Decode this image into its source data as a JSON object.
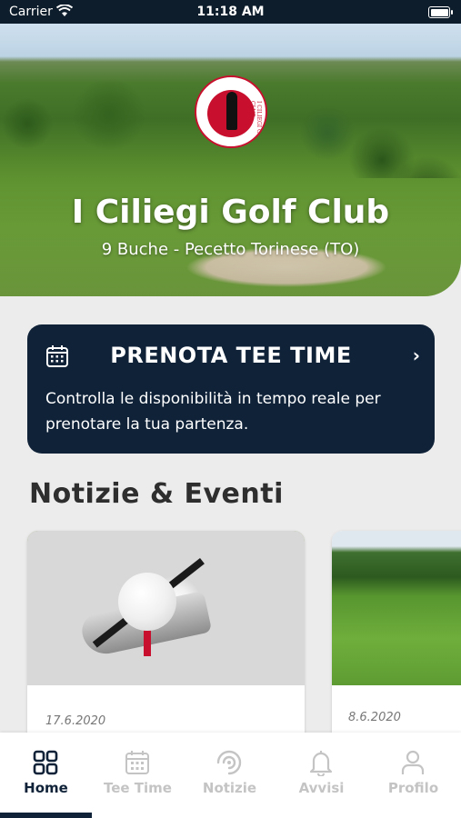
{
  "status_bar": {
    "carrier": "Carrier",
    "time": "11:18 AM"
  },
  "hero": {
    "club_name": "I Ciliegi Golf Club",
    "subtitle": "9 Buche - Pecetto Torinese (TO)",
    "logo_text": "I CILIEGI GOLF CLUB"
  },
  "tee_time_card": {
    "title": "PRENOTA TEE TIME",
    "description": "Controlla le disponibilità in tempo reale per prenotare la tua partenza.",
    "icon": "calendar-icon",
    "chevron_icon": "chevron-right-icon"
  },
  "news": {
    "section_title": "Notizie & Eventi",
    "items": [
      {
        "date": "17.6.2020"
      },
      {
        "date": "8.6.2020"
      }
    ]
  },
  "tab_bar": {
    "tabs": [
      {
        "label": "Home",
        "icon": "grid-icon",
        "active": true
      },
      {
        "label": "Tee Time",
        "icon": "calendar-icon",
        "active": false
      },
      {
        "label": "Notizie",
        "icon": "signal-icon",
        "active": false
      },
      {
        "label": "Avvisi",
        "icon": "bell-icon",
        "active": false
      },
      {
        "label": "Profilo",
        "icon": "user-icon",
        "active": false
      }
    ]
  },
  "colors": {
    "navy": "#0f2238",
    "brand_red": "#c8102e",
    "inactive_tab": "#c4c4c4",
    "background": "#ececec"
  }
}
